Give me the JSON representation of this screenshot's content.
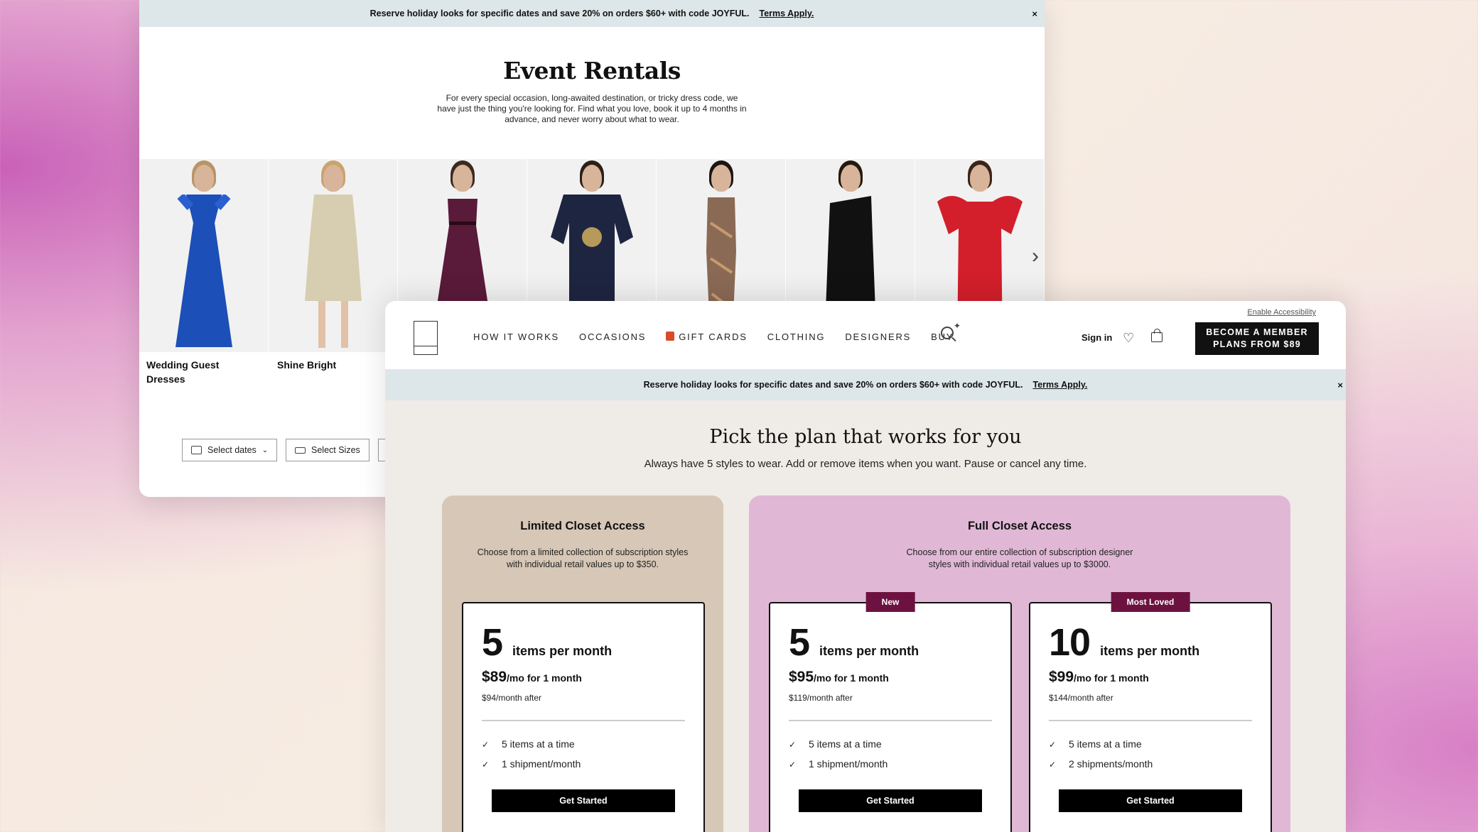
{
  "back_window": {
    "promo": {
      "text": "Reserve holiday looks for specific dates and save 20% on orders $60+ with code JOYFUL.",
      "link": "Terms Apply.",
      "close": "×"
    },
    "title": "Event Rentals",
    "description": "For every special occasion, long-awaited destination, or tricky dress code, we have just the thing you're looking for. Find what you love, book it up to 4 months in advance, and never worry about what to wear.",
    "categories": [
      "Wedding Guest Dresses",
      "Shine Bright"
    ],
    "next_arrow": "›",
    "filters": {
      "dates": "Select dates",
      "sizes": "Select Sizes"
    }
  },
  "front_window": {
    "nav": {
      "links": [
        "HOW IT WORKS",
        "OCCASIONS",
        "GIFT CARDS",
        "CLOTHING",
        "DESIGNERS",
        "BUY"
      ],
      "sign_in": "Sign in",
      "accessibility": "Enable Accessibility",
      "member_line1": "BECOME A MEMBER",
      "member_line2": "PLANS FROM $89"
    },
    "promo": {
      "text": "Reserve holiday looks for specific dates and save 20% on orders $60+ with code JOYFUL.",
      "link": "Terms Apply.",
      "close": "×"
    },
    "heading": "Pick the plan that works for you",
    "subheading": "Always have 5 styles to wear. Add or remove items when you want. Pause or cancel any time.",
    "limited": {
      "title": "Limited Closet Access",
      "desc": "Choose from a limited collection of subscription styles with individual retail values up to $350."
    },
    "full": {
      "title": "Full Closet Access",
      "desc": "Choose from our entire collection of subscription designer styles with individual retail values up to $3000."
    },
    "plans": [
      {
        "badge": "",
        "qty": "5",
        "unit": "items per month",
        "price": "$89",
        "price_suffix": "/mo for 1 month",
        "after": "$94/month after",
        "f1": "5 items at a time",
        "f2": "1 shipment/month",
        "cta": "Get Started"
      },
      {
        "badge": "New",
        "qty": "5",
        "unit": "items per month",
        "price": "$95",
        "price_suffix": "/mo for 1 month",
        "after": "$119/month after",
        "f1": "5 items at a time",
        "f2": "1 shipment/month",
        "cta": "Get Started"
      },
      {
        "badge": "Most Loved",
        "qty": "10",
        "unit": "items per month",
        "price": "$99",
        "price_suffix": "/mo for 1 month",
        "after": "$144/month after",
        "f1": "5 items at a time",
        "f2": "2 shipments/month",
        "cta": "Get Started"
      }
    ],
    "check": "✓"
  },
  "colors": {
    "badge": "#6d1240",
    "limited_panel": "#d6c7b6",
    "full_panel": "#e0b8d5",
    "promo_bg": "#dde7ea"
  }
}
